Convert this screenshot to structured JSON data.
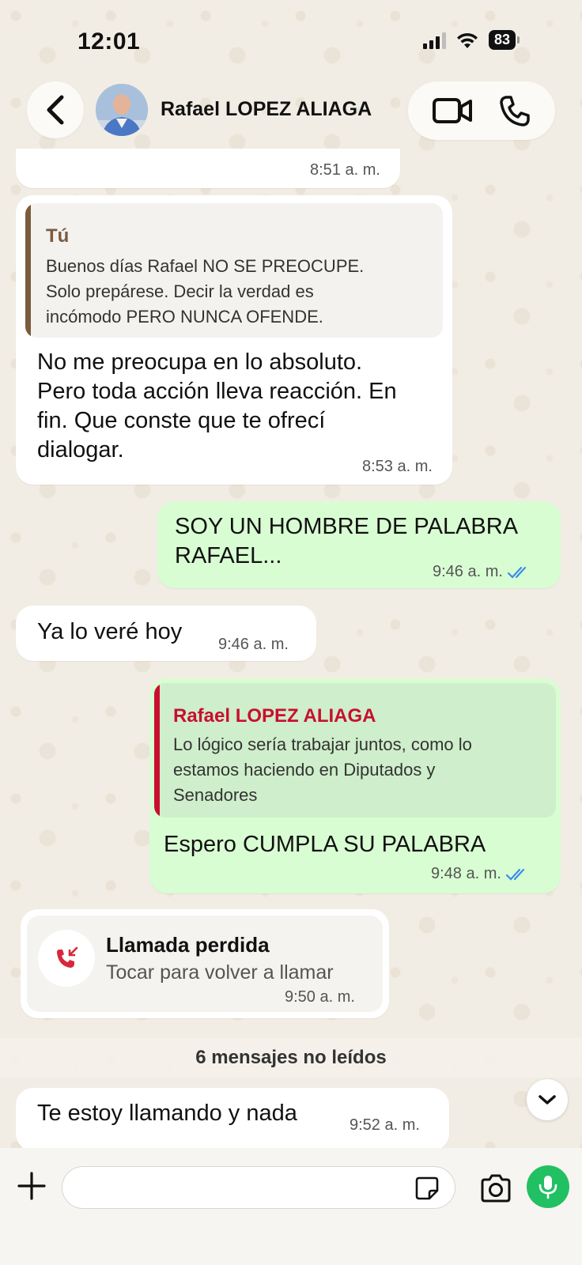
{
  "status_bar": {
    "time": "12:01",
    "battery": "83"
  },
  "header": {
    "contact_name": "Rafael LOPEZ ALIAGA"
  },
  "messages": [
    {
      "type": "text",
      "direction": "in",
      "text": "",
      "time": "8:51 a. m."
    },
    {
      "type": "reply",
      "direction": "in",
      "quoted_author": "Tú",
      "quoted_text_lines": [
        "Buenos días Rafael  NO SE PREOCUPE.",
        "Solo prepárese. Decir la verdad es",
        "incómodo PERO NUNCA OFENDE."
      ],
      "text_lines": [
        "No me preocupa en lo absoluto.",
        "Pero toda acción lleva reacción. En",
        "fin. Que conste que te ofrecí",
        "dialogar."
      ],
      "time": "8:53 a. m."
    },
    {
      "type": "text",
      "direction": "out",
      "text_lines": [
        "SOY UN HOMBRE DE PALABRA",
        "RAFAEL..."
      ],
      "time": "9:46 a. m.",
      "status": "read"
    },
    {
      "type": "text",
      "direction": "in",
      "text": "Ya lo veré hoy",
      "time": "9:46 a. m."
    },
    {
      "type": "reply",
      "direction": "out",
      "quoted_author": "Rafael LOPEZ ALIAGA",
      "quoted_text_lines": [
        "Lo lógico sería trabajar juntos, como lo",
        "estamos haciendo en Diputados y",
        "Senadores"
      ],
      "text": "Espero CUMPLA SU PALABRA",
      "time": "9:48 a. m.",
      "status": "read"
    },
    {
      "type": "missed_call",
      "direction": "in",
      "title": "Llamada perdida",
      "subtitle": "Tocar para volver a llamar",
      "time": "9:50 a. m."
    },
    {
      "type": "text",
      "direction": "in",
      "text": "Te estoy llamando y nada",
      "time": "9:52 a. m."
    }
  ],
  "unread_banner": "6 mensajes no leídos",
  "input": {
    "placeholder": "",
    "value": ""
  },
  "colors": {
    "outgoing_bubble": "#d9fdd3",
    "incoming_bubble": "#ffffff",
    "quote_self_bar": "#7b5a3e",
    "quote_contact_bar": "#c8102e",
    "read_ticks": "#3a8ee6",
    "mic_button": "#21c063",
    "missed_call_icon": "#d6283b"
  }
}
